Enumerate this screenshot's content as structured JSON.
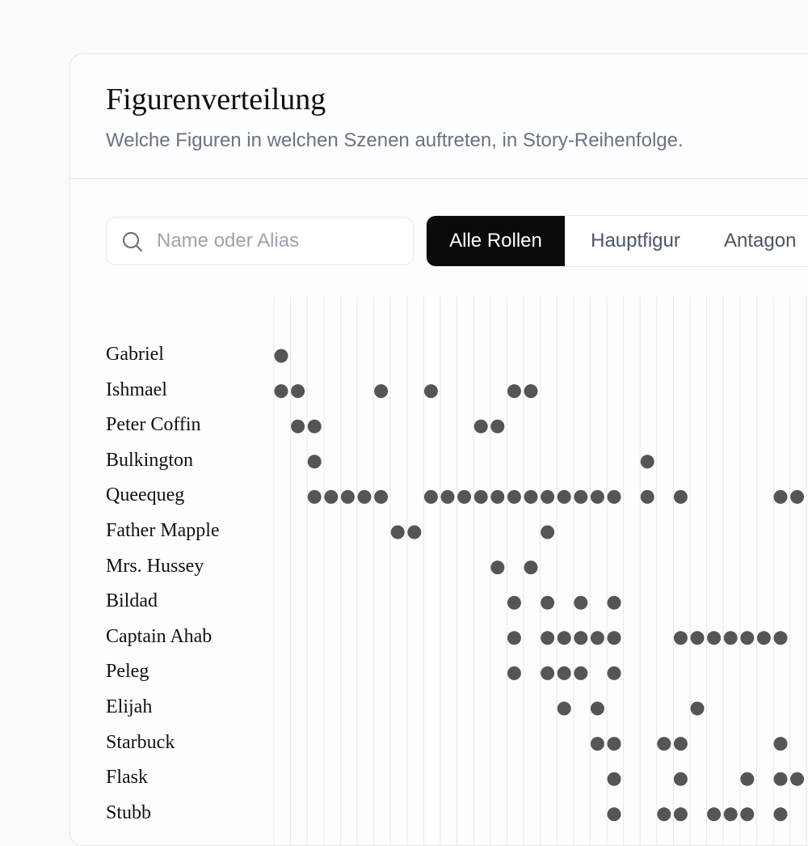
{
  "header": {
    "title": "Figurenverteilung",
    "subtitle": "Welche Figuren in welchen Szenen auftreten, in Story-Reihenfolge."
  },
  "search": {
    "placeholder": "Name oder Alias",
    "value": ""
  },
  "filter": {
    "options": [
      "Alle Rollen",
      "Hauptfigur",
      "Antagon"
    ],
    "selected": "Alle Rollen"
  },
  "colors": {
    "dot": "#555555",
    "gridline": "#e5e7eb",
    "active_bg": "#0a0a0a"
  },
  "matrix": {
    "characters": [
      {
        "name": "Gabriel",
        "scenes": [
          1
        ]
      },
      {
        "name": "Ishmael",
        "scenes": [
          1,
          2,
          7,
          10,
          15,
          16
        ]
      },
      {
        "name": "Peter Coffin",
        "scenes": [
          2,
          3,
          13,
          14
        ]
      },
      {
        "name": "Bulkington",
        "scenes": [
          3,
          23
        ]
      },
      {
        "name": "Queequeg",
        "scenes": [
          3,
          4,
          5,
          6,
          7,
          10,
          11,
          12,
          13,
          14,
          15,
          16,
          17,
          18,
          19,
          20,
          21,
          23,
          25,
          31,
          32
        ]
      },
      {
        "name": "Father Mapple",
        "scenes": [
          8,
          9,
          17
        ]
      },
      {
        "name": "Mrs. Hussey",
        "scenes": [
          14,
          16
        ]
      },
      {
        "name": "Bildad",
        "scenes": [
          15,
          17,
          19,
          21
        ]
      },
      {
        "name": "Captain Ahab",
        "scenes": [
          15,
          17,
          18,
          19,
          20,
          21,
          25,
          26,
          27,
          28,
          29,
          30,
          31
        ]
      },
      {
        "name": "Peleg",
        "scenes": [
          15,
          17,
          18,
          19,
          21
        ]
      },
      {
        "name": "Elijah",
        "scenes": [
          18,
          20,
          26
        ]
      },
      {
        "name": "Starbuck",
        "scenes": [
          20,
          21,
          24,
          25,
          31
        ]
      },
      {
        "name": "Flask",
        "scenes": [
          21,
          25,
          29,
          31,
          32
        ]
      },
      {
        "name": "Stubb",
        "scenes": [
          21,
          24,
          25,
          27,
          28,
          29,
          31
        ]
      }
    ]
  }
}
